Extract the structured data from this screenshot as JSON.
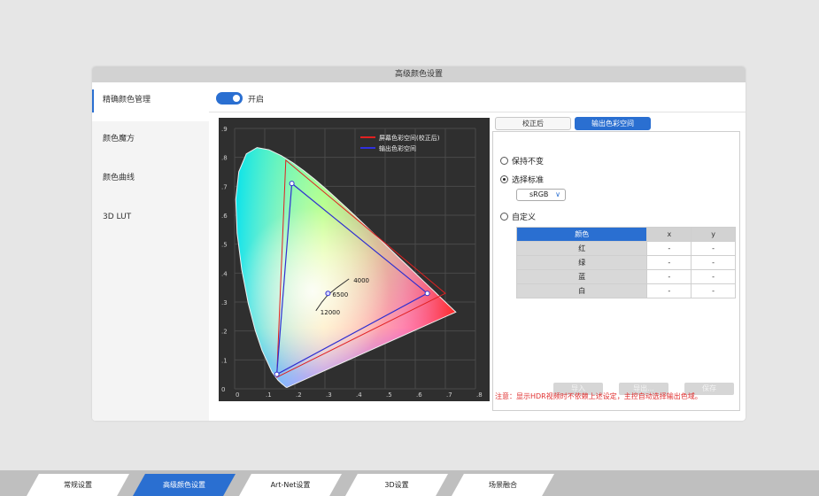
{
  "dialog": {
    "title": "高级颜色设置"
  },
  "sidebar": {
    "items": [
      {
        "label": "精确颜色管理"
      },
      {
        "label": "颜色魔方"
      },
      {
        "label": "颜色曲线"
      },
      {
        "label": "3D LUT"
      }
    ]
  },
  "toggle": {
    "label": "开启",
    "on": true
  },
  "chart_data": {
    "type": "scatter",
    "x_ticks": [
      "0",
      ".1",
      ".2",
      ".3",
      ".4",
      ".5",
      ".6",
      ".7",
      ".8"
    ],
    "y_ticks": [
      "0",
      ".1",
      ".2",
      ".3",
      ".4",
      ".5",
      ".6",
      ".7",
      ".8",
      ".9"
    ],
    "xlim": [
      0,
      0.8
    ],
    "ylim": [
      0,
      0.9
    ],
    "grid": true,
    "legend_position": "top-right",
    "legend": [
      {
        "name": "屏幕色彩空间(校正后)",
        "color": "#e02020"
      },
      {
        "name": "输出色彩空间",
        "color": "#3030e0"
      }
    ],
    "output_triangle": [
      [
        0.64,
        0.33
      ],
      [
        0.19,
        0.71
      ],
      [
        0.14,
        0.05
      ]
    ],
    "screen_triangle": [
      [
        0.7,
        0.33
      ],
      [
        0.17,
        0.79
      ],
      [
        0.14,
        0.04
      ]
    ],
    "white_point": [
      0.31,
      0.33
    ],
    "cct_labels": [
      {
        "text": "4000",
        "x": 0.38,
        "y": 0.38
      },
      {
        "text": "6500",
        "x": 0.31,
        "y": 0.33
      },
      {
        "text": "12000",
        "x": 0.27,
        "y": 0.27
      }
    ]
  },
  "tabs": [
    {
      "label": "校正后",
      "active": false
    },
    {
      "label": "输出色彩空间",
      "active": true
    }
  ],
  "options": {
    "keep": "保持不变",
    "select_standard": "选择标准",
    "custom": "自定义",
    "selected": "select_standard",
    "standard_value": "sRGB"
  },
  "table": {
    "headers": [
      "颜色",
      "x",
      "y"
    ],
    "rows": [
      {
        "name": "红",
        "x": "-",
        "y": "-"
      },
      {
        "name": "绿",
        "x": "-",
        "y": "-"
      },
      {
        "name": "蓝",
        "x": "-",
        "y": "-"
      },
      {
        "name": "白",
        "x": "-",
        "y": "-"
      }
    ]
  },
  "buttons": {
    "import": "导入",
    "export": "导出...",
    "save": "保存"
  },
  "note": "注意：显示HDR视频时不依赖上述设定，主控自动选择输出色域。",
  "bottom_tabs": [
    {
      "label": "常规设置",
      "active": false
    },
    {
      "label": "高级颜色设置",
      "active": true
    },
    {
      "label": "Art-Net设置",
      "active": false
    },
    {
      "label": "3D设置",
      "active": false
    },
    {
      "label": "场景融合",
      "active": false
    }
  ],
  "colors": {
    "accent": "#2a6fd1",
    "warning": "#e03030",
    "chart_bg": "#2f2f2f"
  }
}
